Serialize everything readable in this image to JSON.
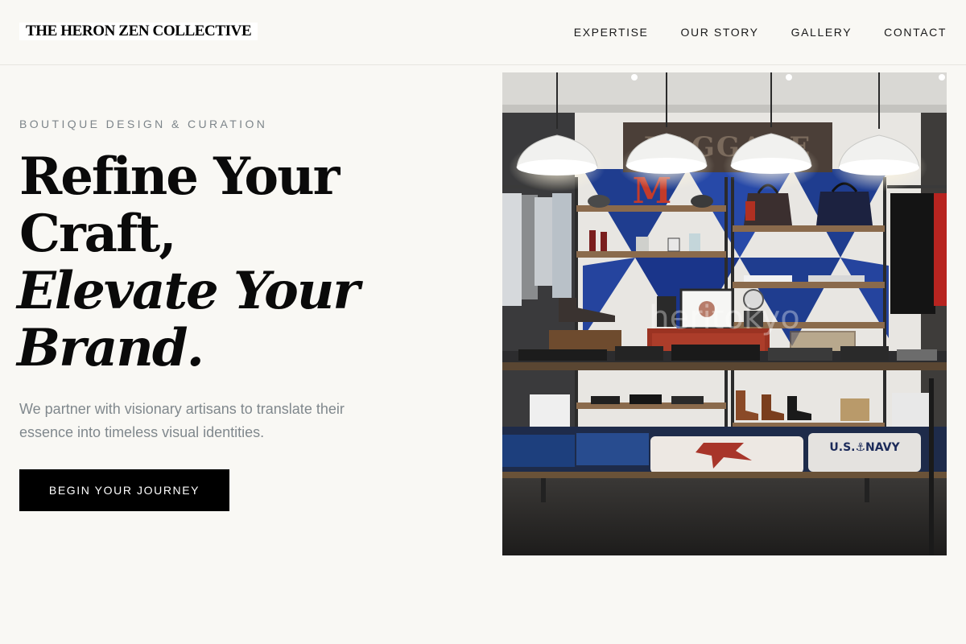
{
  "brand": {
    "name": "THE HERON ZEN COLLECTIVE"
  },
  "nav": {
    "items": [
      {
        "label": "EXPERTISE"
      },
      {
        "label": "OUR STORY"
      },
      {
        "label": "GALLERY"
      },
      {
        "label": "CONTACT"
      }
    ]
  },
  "hero": {
    "eyebrow": "BOUTIQUE DESIGN & CURATION",
    "headline": {
      "line1": "Refine Your",
      "line2": "Craft,",
      "line3": "Elevate Your",
      "line4": "Brand."
    },
    "subtitle": "We partner with visionary artisans to translate their essence into timeless visual identities.",
    "cta_label": "BEGIN YOUR JOURNEY"
  },
  "image": {
    "sign_text": "BAGGAGE",
    "letter": "M",
    "watermark": "heritokyo",
    "sweatshirt_text": "U.S.⚓NAVY"
  },
  "colors": {
    "background": "#f9f8f4",
    "text": "#0a0a0a",
    "muted": "#7d858a",
    "button": "#000000",
    "button_text": "#ffffff"
  }
}
